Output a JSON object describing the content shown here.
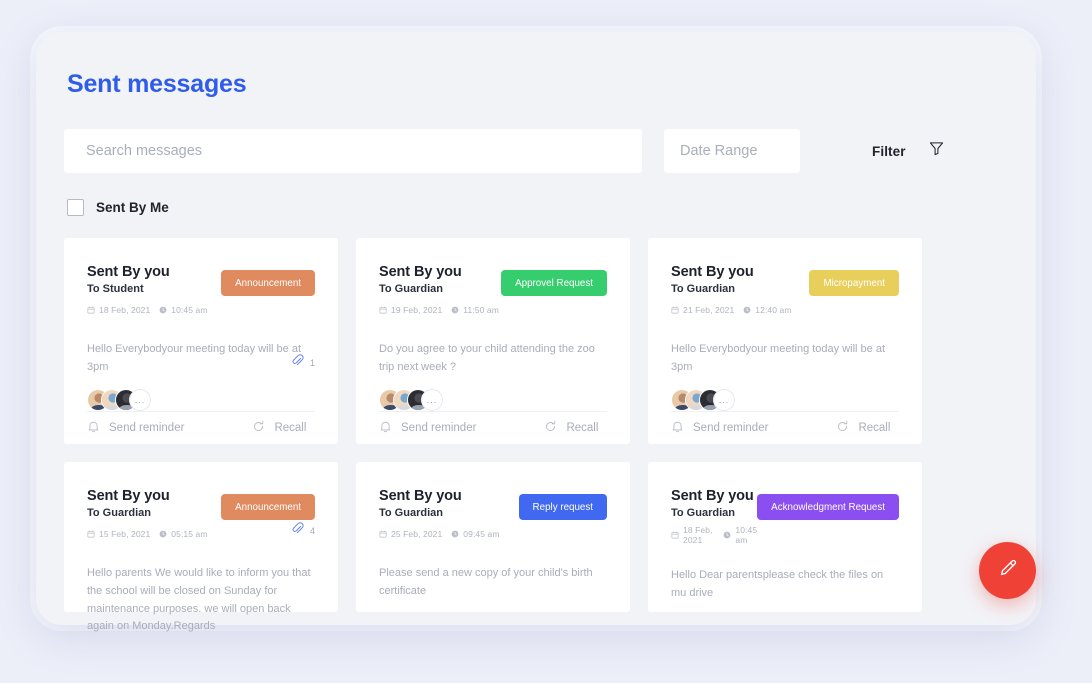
{
  "header": {
    "title": "Sent messages"
  },
  "search": {
    "placeholder": "Search messages",
    "value": ""
  },
  "date_range": {
    "placeholder": "Date Range",
    "value": ""
  },
  "filter": {
    "label": "Filter",
    "icon": "funnel-icon"
  },
  "sent_by_me": {
    "label": "Sent By Me",
    "checked": false
  },
  "icons": {
    "calendar": "calendar-icon",
    "clock": "clock-icon",
    "bell": "bell-icon",
    "refresh": "refresh-icon",
    "paperclip": "paperclip-icon",
    "pencil": "pencil-icon"
  },
  "actions": {
    "send_reminder": "Send reminder",
    "recall": "Recall"
  },
  "avatar_overflow": "...",
  "fab": {
    "icon": "pencil-icon",
    "color": "#ef4136"
  },
  "colors": {
    "accent": "#2f5ce8",
    "announcement": "#e08a5f",
    "approval": "#35cd6e",
    "micropayment": "#e8ce5a",
    "reply": "#4168f0",
    "acknowledgment": "#8b4ef0",
    "page_bg": "#eceef8",
    "panel_bg": "#f2f3f7",
    "card_bg": "#ffffff"
  },
  "cards": [
    {
      "sender": "Sent By you",
      "recipient": "To Student",
      "date": "18 Feb, 2021",
      "time": "10:45 am",
      "badge": "Announcement",
      "badge_color": "#e08a5f",
      "message": "Hello Everybodyour meeting today will be at 3pm",
      "attachments": "1",
      "has_avatars": true,
      "has_footer": true
    },
    {
      "sender": "Sent By you",
      "recipient": "To Guardian",
      "date": "19 Feb, 2021",
      "time": "11:50 am",
      "badge": "Approvel Request",
      "badge_color": "#35cd6e",
      "message": "Do you agree to your child attending the zoo trip next week ?",
      "attachments": "",
      "has_avatars": true,
      "has_footer": true
    },
    {
      "sender": "Sent By you",
      "recipient": "To Guardian",
      "date": "21 Feb, 2021",
      "time": "12:40 am",
      "badge": "Micropayment",
      "badge_color": "#e8ce5a",
      "message": "Hello Everybodyour meeting today will be at 3pm",
      "attachments": "",
      "has_avatars": true,
      "has_footer": true
    },
    {
      "sender": "Sent By you",
      "recipient": "To Guardian",
      "date": "15 Feb, 2021",
      "time": "05:15 am",
      "badge": "Announcement",
      "badge_color": "#e08a5f",
      "message": "Hello parents We would like to inform you that the school will be closed on Sunday for maintenance purposes. we will open back again on Monday.Regards",
      "attachments": "4",
      "has_avatars": false,
      "has_footer": false
    },
    {
      "sender": "Sent By you",
      "recipient": "To Guardian",
      "date": "25 Feb, 2021",
      "time": "09:45 am",
      "badge": "Reply request",
      "badge_color": "#4168f0",
      "message": "Please send a new copy of your child's birth certificate",
      "attachments": "",
      "has_avatars": false,
      "has_footer": false
    },
    {
      "sender": "Sent By you",
      "recipient": "To Guardian",
      "date": "18 Feb, 2021",
      "time": "10:45 am",
      "badge": "Acknowledgment Request",
      "badge_color": "#8b4ef0",
      "message": "Hello Dear parentsplease check the files on mu drive",
      "attachments": "",
      "has_avatars": false,
      "has_footer": false
    }
  ]
}
